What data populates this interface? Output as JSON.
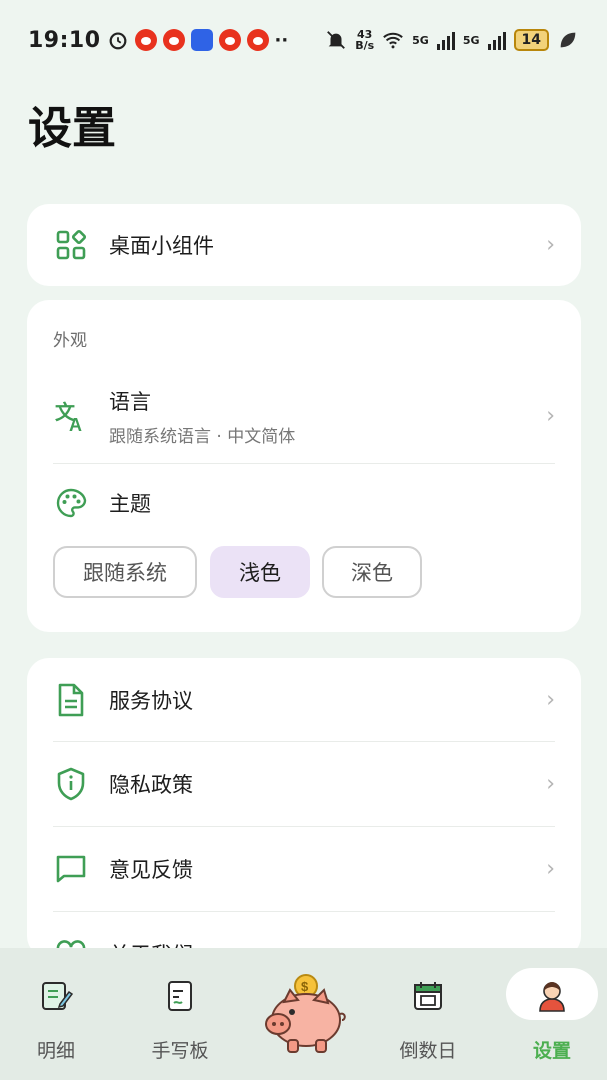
{
  "status_bar": {
    "time": "19:10",
    "net_speed_value": "43",
    "net_speed_unit": "B/s",
    "sim1": "5G",
    "sim2": "5G",
    "battery": "14"
  },
  "page": {
    "title": "设置"
  },
  "widget_card": {
    "label": "桌面小组件"
  },
  "appearance": {
    "section_title": "外观",
    "language_label": "语言",
    "language_value": "跟随系统语言 · 中文简体",
    "theme_label": "主题",
    "theme_options": [
      "跟随系统",
      "浅色",
      "深色"
    ],
    "theme_selected": "浅色"
  },
  "info_card": {
    "items": [
      "服务协议",
      "隐私政策",
      "意见反馈",
      "关于我们"
    ]
  },
  "bottom_nav": {
    "items": [
      "明细",
      "手写板",
      "倒数日",
      "设置"
    ],
    "active": "设置"
  },
  "colors": {
    "accent": "#4caf50",
    "icon_green": "#3f9e55",
    "selected_theme_bg": "#ebe2f6"
  }
}
